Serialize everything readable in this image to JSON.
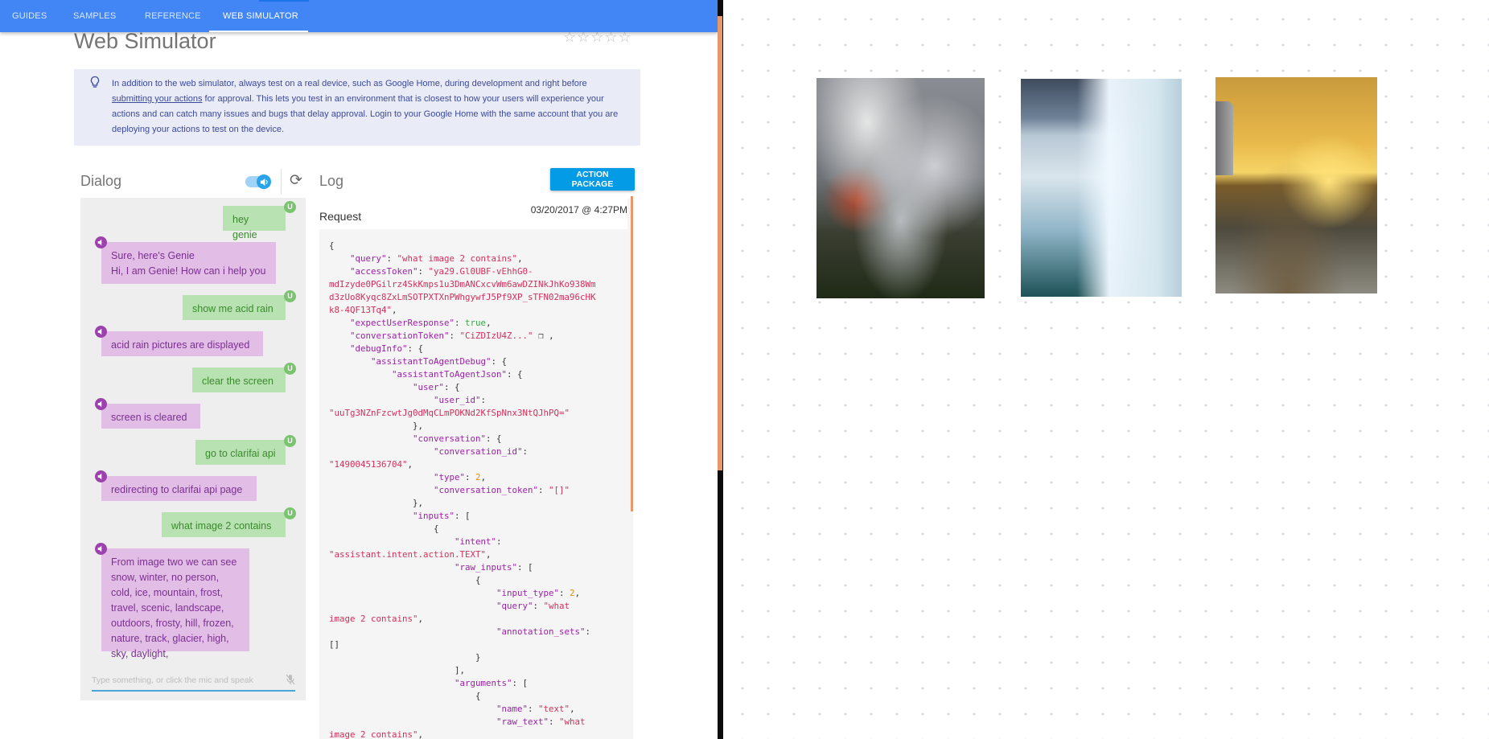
{
  "nav": {
    "tabs": [
      "GUIDES",
      "SAMPLES",
      "REFERENCE",
      "WEB SIMULATOR"
    ],
    "active_tab": "WEB SIMULATOR"
  },
  "page": {
    "title": "Web Simulator",
    "rating_stars": "☆☆☆☆☆"
  },
  "notice": {
    "text_before": "In addition to the web simulator, always test on a real device, such as Google Home, during development and right before ",
    "link": "submitting your actions",
    "text_after": " for approval. This lets you test in an environment that is closest to how your users will experience your actions and can catch many issues and bugs that delay approval. Login to your Google Home with the same account that you are deploying your actions to test on the device.",
    "icon": "lightbulb-icon"
  },
  "dialog": {
    "title": "Dialog",
    "user_badge": "U",
    "input_placeholder": "Type something, or click the mic and speak",
    "messages": [
      {
        "from": "user",
        "text": "hey genie"
      },
      {
        "from": "bot",
        "text": "Sure, here's Genie\nHi, I am Genie! How can i help you"
      },
      {
        "from": "user",
        "text": "show me acid rain"
      },
      {
        "from": "bot",
        "text": "acid rain pictures are displayed"
      },
      {
        "from": "user",
        "text": "clear the screen"
      },
      {
        "from": "bot",
        "text": "screen is cleared"
      },
      {
        "from": "user",
        "text": "go to clarifai api"
      },
      {
        "from": "bot",
        "text": "redirecting to clarifai api page"
      },
      {
        "from": "user",
        "text": "what image 2 contains"
      },
      {
        "from": "bot",
        "text": "From image two we can see snow, winter, no person, cold, ice, mountain, frost, travel, scenic, landscape, outdoors, frosty, hill, frozen, nature, track, glacier, high, sky, daylight,"
      }
    ]
  },
  "log": {
    "title": "Log",
    "action_button": "ACTION PACKAGE",
    "request_label": "Request",
    "timestamp": "03/20/2017 @ 4:27PM",
    "json_lines": [
      [
        [
          "p",
          "{"
        ]
      ],
      [
        [
          "p",
          "    "
        ],
        [
          "k",
          "\"query\""
        ],
        [
          "p",
          ": "
        ],
        [
          "s",
          "\"what image 2 contains\""
        ],
        [
          "p",
          ","
        ]
      ],
      [
        [
          "p",
          "    "
        ],
        [
          "k",
          "\"accessToken\""
        ],
        [
          "p",
          ": "
        ],
        [
          "s",
          "\"ya29.Gl0UBF-vEhhG0-"
        ]
      ],
      [
        [
          "s",
          "mdIzyde0PGilrz4SkKmps1u3DmANCxcvWm6awDZINkJhKo938Wm"
        ]
      ],
      [
        [
          "s",
          "d3zUo8Kyqc8ZxLmSOTPXTXnPWhgywfJ5Pf9XP_sTFN02ma96cHK"
        ]
      ],
      [
        [
          "s",
          "k8-4QF13Tq4\""
        ],
        [
          "p",
          ","
        ]
      ],
      [
        [
          "p",
          "    "
        ],
        [
          "k",
          "\"expectUserResponse\""
        ],
        [
          "p",
          ": "
        ],
        [
          "b",
          "true"
        ],
        [
          "p",
          ","
        ]
      ],
      [
        [
          "p",
          "    "
        ],
        [
          "k",
          "\"conversationToken\""
        ],
        [
          "p",
          ": "
        ],
        [
          "s",
          "\"CiZDIzU4Z...\""
        ],
        [
          "p",
          " ❐ ,"
        ]
      ],
      [
        [
          "p",
          "    "
        ],
        [
          "k",
          "\"debugInfo\""
        ],
        [
          "p",
          ": {"
        ]
      ],
      [
        [
          "p",
          "        "
        ],
        [
          "k",
          "\"assistantToAgentDebug\""
        ],
        [
          "p",
          ": {"
        ]
      ],
      [
        [
          "p",
          "            "
        ],
        [
          "k",
          "\"assistantToAgentJson\""
        ],
        [
          "p",
          ": {"
        ]
      ],
      [
        [
          "p",
          "                "
        ],
        [
          "k",
          "\"user\""
        ],
        [
          "p",
          ": {"
        ]
      ],
      [
        [
          "p",
          "                    "
        ],
        [
          "k",
          "\"user_id\""
        ],
        [
          "p",
          ":"
        ]
      ],
      [
        [
          "s",
          "\"uuTg3NZnFzcwtJg0dMqCLmPOKNd2KfSpNnx3NtQJhPQ=\""
        ]
      ],
      [
        [
          "p",
          "                },"
        ]
      ],
      [
        [
          "p",
          "                "
        ],
        [
          "k",
          "\"conversation\""
        ],
        [
          "p",
          ": {"
        ]
      ],
      [
        [
          "p",
          "                    "
        ],
        [
          "k",
          "\"conversation_id\""
        ],
        [
          "p",
          ":"
        ]
      ],
      [
        [
          "s",
          "\"1490045136704\""
        ],
        [
          "p",
          ","
        ]
      ],
      [
        [
          "p",
          "                    "
        ],
        [
          "k",
          "\"type\""
        ],
        [
          "p",
          ": "
        ],
        [
          "n",
          "2"
        ],
        [
          "p",
          ","
        ]
      ],
      [
        [
          "p",
          "                    "
        ],
        [
          "k",
          "\"conversation_token\""
        ],
        [
          "p",
          ": "
        ],
        [
          "s",
          "\"[]\""
        ]
      ],
      [
        [
          "p",
          "                },"
        ]
      ],
      [
        [
          "p",
          "                "
        ],
        [
          "k",
          "\"inputs\""
        ],
        [
          "p",
          ": ["
        ]
      ],
      [
        [
          "p",
          "                    {"
        ]
      ],
      [
        [
          "p",
          "                        "
        ],
        [
          "k",
          "\"intent\""
        ],
        [
          "p",
          ":"
        ]
      ],
      [
        [
          "s",
          "\"assistant.intent.action.TEXT\""
        ],
        [
          "p",
          ","
        ]
      ],
      [
        [
          "p",
          "                        "
        ],
        [
          "k",
          "\"raw_inputs\""
        ],
        [
          "p",
          ": ["
        ]
      ],
      [
        [
          "p",
          "                            {"
        ]
      ],
      [
        [
          "p",
          "                                "
        ],
        [
          "k",
          "\"input_type\""
        ],
        [
          "p",
          ": "
        ],
        [
          "n",
          "2"
        ],
        [
          "p",
          ","
        ]
      ],
      [
        [
          "p",
          "                                "
        ],
        [
          "k",
          "\"query\""
        ],
        [
          "p",
          ": "
        ],
        [
          "s",
          "\"what"
        ]
      ],
      [
        [
          "s",
          "image 2 contains\""
        ],
        [
          "p",
          ","
        ]
      ],
      [
        [
          "p",
          "                                "
        ],
        [
          "k",
          "\"annotation_sets\""
        ],
        [
          "p",
          ":"
        ]
      ],
      [
        [
          "p",
          "[]"
        ]
      ],
      [
        [
          "p",
          "                            }"
        ]
      ],
      [
        [
          "p",
          "                        ],"
        ]
      ],
      [
        [
          "p",
          "                        "
        ],
        [
          "k",
          "\"arguments\""
        ],
        [
          "p",
          ": ["
        ]
      ],
      [
        [
          "p",
          "                            {"
        ]
      ],
      [
        [
          "p",
          "                                "
        ],
        [
          "k",
          "\"name\""
        ],
        [
          "p",
          ": "
        ],
        [
          "s",
          "\"text\""
        ],
        [
          "p",
          ","
        ]
      ],
      [
        [
          "p",
          "                                "
        ],
        [
          "k",
          "\"raw_text\""
        ],
        [
          "p",
          ": "
        ],
        [
          "s",
          "\"what"
        ]
      ],
      [
        [
          "s",
          "image 2 contains\""
        ],
        [
          "p",
          ","
        ]
      ]
    ]
  },
  "images": [
    {
      "name": "forest-fire-smoke-image"
    },
    {
      "name": "glacier-ice-wall-image"
    },
    {
      "name": "arctic-sunset-sea-image"
    }
  ],
  "colors": {
    "header": "#4285f4",
    "notice_bg": "#e9ebf7",
    "user_bubble": "#b9e2b2",
    "bot_bubble": "#e2bde6",
    "action_button": "#039be5",
    "scroll_accent": "#e8976a"
  }
}
